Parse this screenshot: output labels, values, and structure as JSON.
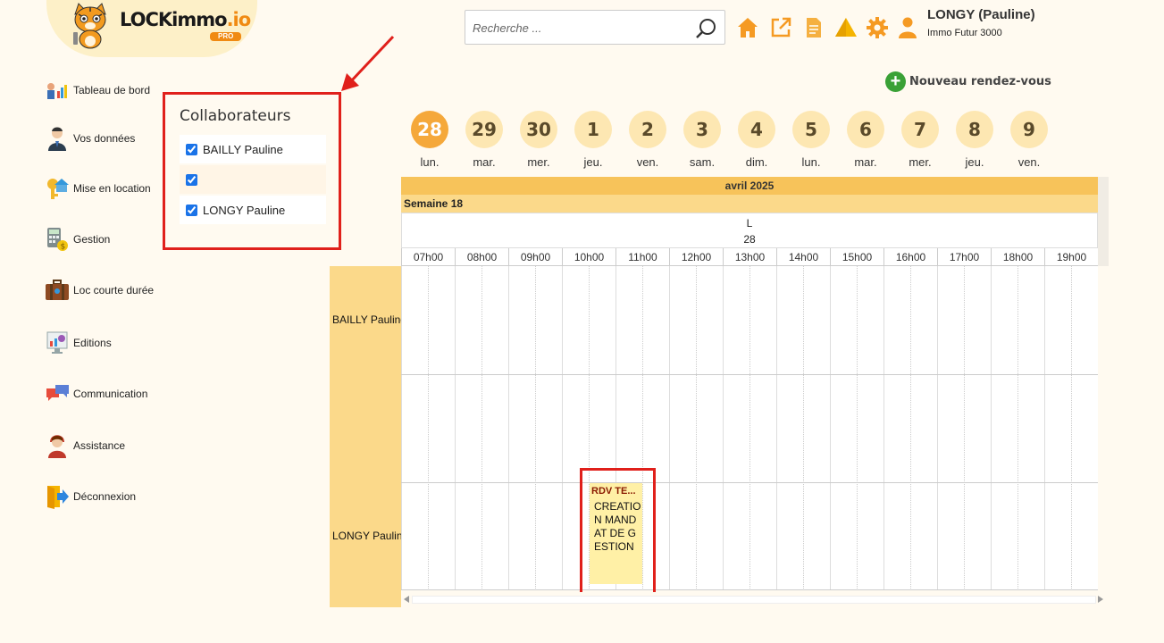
{
  "brand": {
    "name_main": "LOCKimmo",
    "name_suffix": ".io",
    "badge": "PRO"
  },
  "search": {
    "placeholder": "Recherche ..."
  },
  "user": {
    "name": "LONGY (Pauline)",
    "company": "Immo Futur 3000"
  },
  "top_icons": [
    "home-icon",
    "external-link-icon",
    "document-icon",
    "alert-triangle-icon",
    "gear-icon",
    "user-icon"
  ],
  "sidebar": {
    "items": [
      {
        "label": "Tableau de bord",
        "icon": "dashboard-chart-icon"
      },
      {
        "label": "Vos données",
        "icon": "person-icon"
      },
      {
        "label": "Mise en location",
        "icon": "key-house-icon"
      },
      {
        "label": "Gestion",
        "icon": "calculator-money-icon"
      },
      {
        "label": "Loc courte durée",
        "icon": "suitcase-icon"
      },
      {
        "label": "Editions",
        "icon": "report-chart-icon"
      },
      {
        "label": "Communication",
        "icon": "chat-bubbles-icon"
      },
      {
        "label": "Assistance",
        "icon": "support-agent-icon"
      },
      {
        "label": "Déconnexion",
        "icon": "logout-icon"
      }
    ]
  },
  "collaborators": {
    "title": "Collaborateurs",
    "items": [
      {
        "label": "BAILLY Pauline",
        "checked": true
      },
      {
        "label": "",
        "checked": true
      },
      {
        "label": "LONGY Pauline",
        "checked": true
      }
    ]
  },
  "new_appointment": {
    "label": "Nouveau rendez-vous"
  },
  "days": [
    {
      "num": "28",
      "name": "lun.",
      "selected": true
    },
    {
      "num": "29",
      "name": "mar.",
      "selected": false
    },
    {
      "num": "30",
      "name": "mer.",
      "selected": false
    },
    {
      "num": "1",
      "name": "jeu.",
      "selected": false
    },
    {
      "num": "2",
      "name": "ven.",
      "selected": false
    },
    {
      "num": "3",
      "name": "sam.",
      "selected": false
    },
    {
      "num": "4",
      "name": "dim.",
      "selected": false
    },
    {
      "num": "5",
      "name": "lun.",
      "selected": false
    },
    {
      "num": "6",
      "name": "mar.",
      "selected": false
    },
    {
      "num": "7",
      "name": "mer.",
      "selected": false
    },
    {
      "num": "8",
      "name": "jeu.",
      "selected": false
    },
    {
      "num": "9",
      "name": "ven.",
      "selected": false
    }
  ],
  "scheduler": {
    "month": "avril 2025",
    "week": "Semaine 18",
    "day_letter": "L",
    "day_num": "28",
    "hours": [
      "07h00",
      "08h00",
      "09h00",
      "10h00",
      "11h00",
      "12h00",
      "13h00",
      "14h00",
      "15h00",
      "16h00",
      "17h00",
      "18h00",
      "19h00"
    ],
    "resources": [
      "BAILLY Pauline",
      "",
      "LONGY Pauline"
    ],
    "event": {
      "title": "RDV TE...",
      "text": "CREATION MANDAT DE GESTION"
    }
  },
  "colors": {
    "accent_orange": "#f08a12",
    "highlight_red": "#e0201b",
    "header_yellow": "#f7c35a",
    "resource_yellow": "#fbd98a",
    "event_yellow": "#fff0a6",
    "add_green": "#3aa136"
  }
}
